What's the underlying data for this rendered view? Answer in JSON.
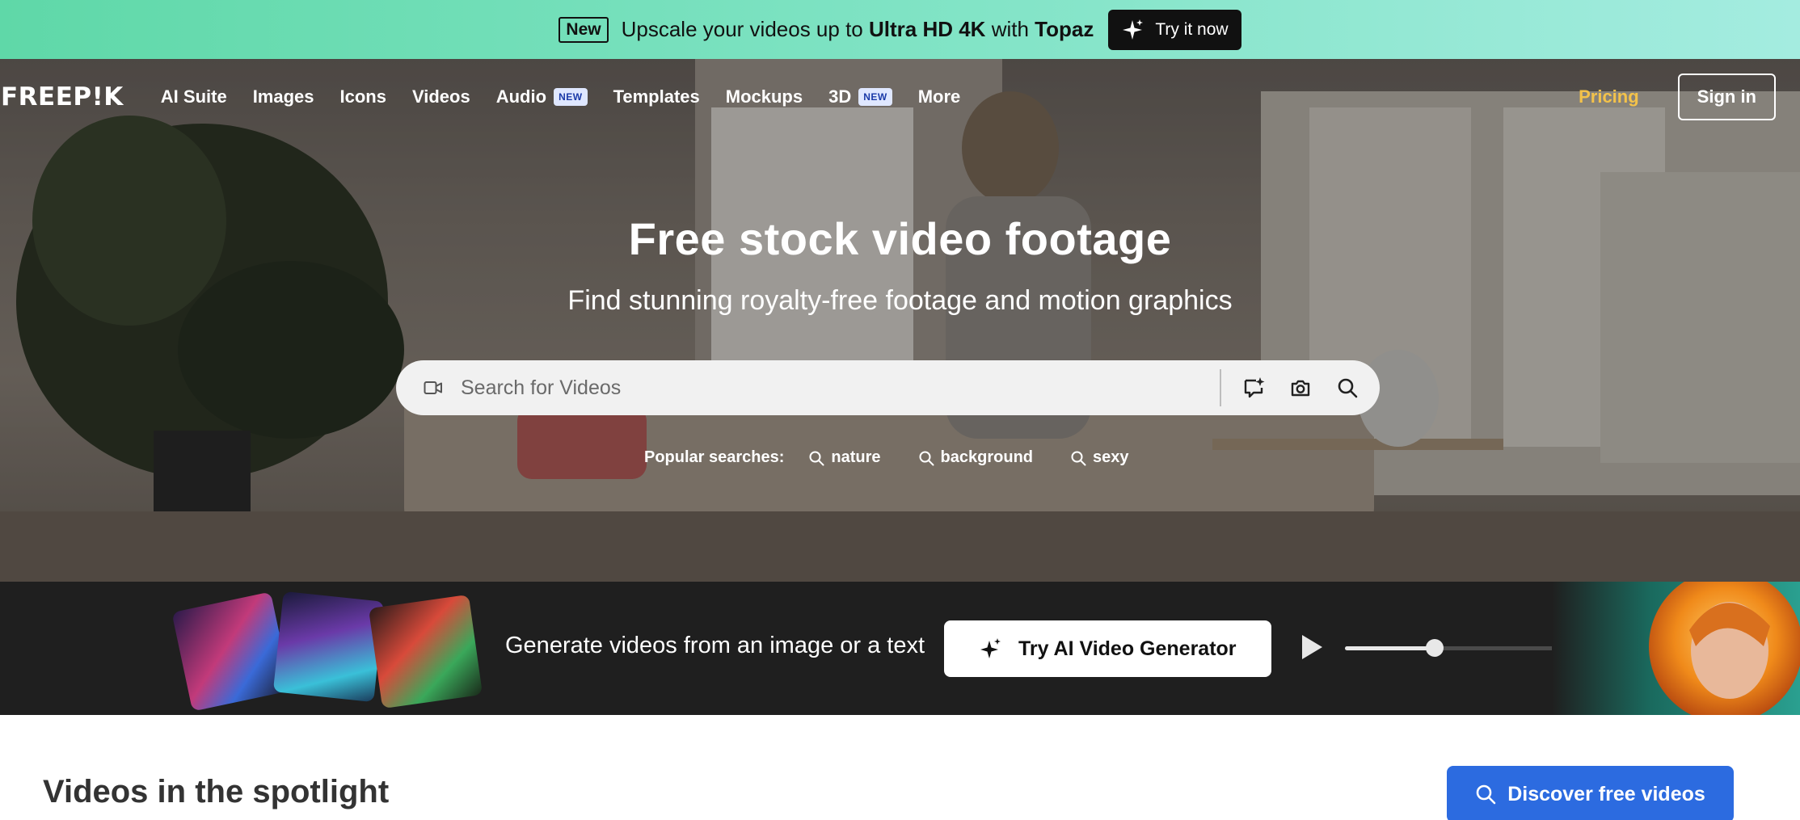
{
  "promo": {
    "badge": "New",
    "text_prefix": "Upscale your videos up to ",
    "text_bold1": "Ultra HD 4K",
    "text_mid": " with ",
    "text_bold2": "Topaz",
    "cta_label": "Try it now"
  },
  "nav": {
    "logo": "FREEP!K",
    "items": [
      {
        "label": "AI Suite"
      },
      {
        "label": "Images"
      },
      {
        "label": "Icons"
      },
      {
        "label": "Videos"
      },
      {
        "label": "Audio",
        "badge": "NEW"
      },
      {
        "label": "Templates"
      },
      {
        "label": "Mockups"
      },
      {
        "label": "3D",
        "badge": "NEW"
      },
      {
        "label": "More"
      }
    ],
    "pricing": "Pricing",
    "sign_in": "Sign in"
  },
  "hero": {
    "title": "Free stock video footage",
    "subtitle": "Find stunning royalty-free footage and motion graphics"
  },
  "search": {
    "placeholder": "Search for Videos",
    "icons": [
      "video-camera-icon",
      "ai-chat-sparkle-icon",
      "camera-icon",
      "search-icon"
    ]
  },
  "popular": {
    "label": "Popular searches:",
    "tags": [
      "nature",
      "background",
      "sexy"
    ]
  },
  "ai_strip": {
    "text": "Generate videos from an image or a text",
    "button": "Try AI Video Generator",
    "progress": 0.36
  },
  "spotlight": {
    "title": "Videos in the spotlight",
    "button": "Discover free videos"
  },
  "colors": {
    "promo_green": "#5fd8a8",
    "pricing_gold": "#f3c24a",
    "discover_blue": "#2c6be0",
    "strip_dark": "#1f1f1f"
  }
}
